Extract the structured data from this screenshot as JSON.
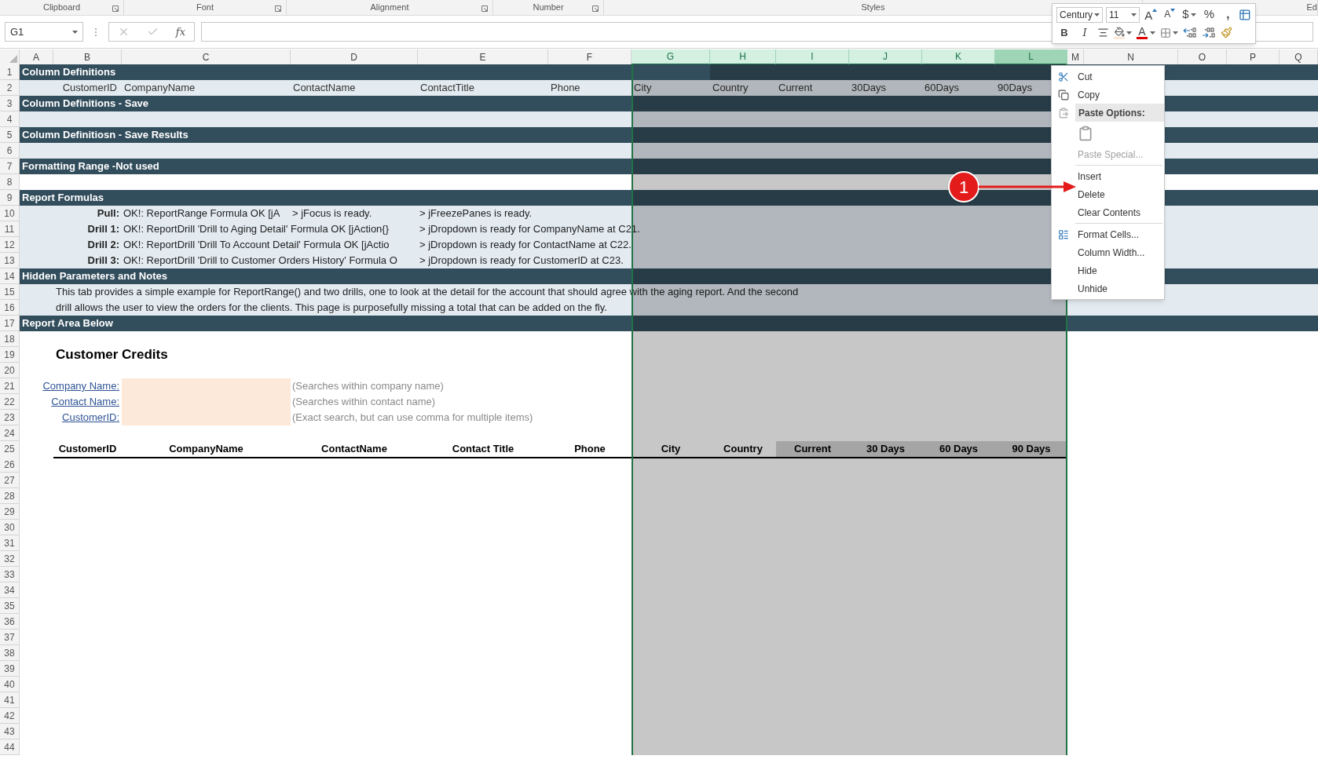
{
  "ribbon_groups": [
    {
      "label": "Clipboard",
      "launcher": true
    },
    {
      "label": "Font",
      "launcher": true
    },
    {
      "label": "Alignment",
      "launcher": true
    },
    {
      "label": "Number",
      "launcher": true
    },
    {
      "label": "Styles",
      "launcher": false
    },
    {
      "label": "Ed",
      "launcher": false
    }
  ],
  "formula_bar": {
    "name_box": "G1",
    "function_symbol": "fx"
  },
  "columns": [
    {
      "label": "A",
      "selected": false,
      "hovered": false
    },
    {
      "label": "B",
      "selected": false,
      "hovered": false
    },
    {
      "label": "C",
      "selected": false,
      "hovered": false
    },
    {
      "label": "D",
      "selected": false,
      "hovered": false
    },
    {
      "label": "E",
      "selected": false,
      "hovered": false
    },
    {
      "label": "F",
      "selected": false,
      "hovered": false
    },
    {
      "label": "G",
      "selected": true,
      "hovered": false
    },
    {
      "label": "H",
      "selected": true,
      "hovered": false
    },
    {
      "label": "I",
      "selected": true,
      "hovered": false
    },
    {
      "label": "J",
      "selected": true,
      "hovered": false
    },
    {
      "label": "K",
      "selected": true,
      "hovered": false
    },
    {
      "label": "L",
      "selected": true,
      "hovered": true
    },
    {
      "label": "M",
      "selected": false,
      "hovered": false
    },
    {
      "label": "N",
      "selected": false,
      "hovered": false
    },
    {
      "label": "O",
      "selected": false,
      "hovered": false
    },
    {
      "label": "P",
      "selected": false,
      "hovered": false
    },
    {
      "label": "Q",
      "selected": false,
      "hovered": false
    }
  ],
  "rows": [
    {
      "number": "1",
      "kind": "section",
      "title": "Column Definitions"
    },
    {
      "number": "2",
      "kind": "definitions",
      "values": [
        "CustomerID",
        "CompanyName",
        "ContactName",
        "ContactTitle",
        "Phone",
        "City",
        "Country",
        "Current",
        "30Days",
        "60Days",
        "90Days"
      ]
    },
    {
      "number": "3",
      "kind": "section",
      "title": "Column Definitions - Save"
    },
    {
      "number": "4",
      "kind": "light_blank"
    },
    {
      "number": "5",
      "kind": "section",
      "title": "Column Definitiosn - Save Results"
    },
    {
      "number": "6",
      "kind": "light_blank"
    },
    {
      "number": "7",
      "kind": "section",
      "title": "Formatting Range -Not used"
    },
    {
      "number": "8",
      "kind": "blank"
    },
    {
      "number": "9",
      "kind": "section",
      "title": "Report Formulas"
    },
    {
      "number": "10",
      "kind": "formula",
      "label": "Pull:",
      "result": "OK!: ReportRange Formula OK [jA",
      "messages": [
        "> jFocus is ready.",
        "> jFreezePanes is ready."
      ]
    },
    {
      "number": "11",
      "kind": "formula",
      "label": "Drill 1:",
      "result": "OK!: ReportDrill 'Drill to Aging Detail' Formula OK [jAction{}",
      "messages": [
        "> jDropdown is ready for CompanyName at C21."
      ]
    },
    {
      "number": "12",
      "kind": "formula",
      "label": "Drill 2:",
      "result": "OK!: ReportDrill 'Drill To Account Detail' Formula OK [jActio",
      "messages": [
        "> jDropdown is ready for ContactName at C22."
      ]
    },
    {
      "number": "13",
      "kind": "formula",
      "label": "Drill 3:",
      "result": "OK!: ReportDrill 'Drill to Customer Orders History' Formula O",
      "messages": [
        "> jDropdown is ready for CustomerID at C23."
      ]
    },
    {
      "number": "14",
      "kind": "section",
      "title": "Hidden Parameters and Notes"
    },
    {
      "number": "15",
      "kind": "note",
      "text": "This tab provides a simple example for ReportRange() and two drills, one to look at the detail for the account that should agree with the aging report. And the second"
    },
    {
      "number": "16",
      "kind": "note",
      "text": "drill allows the user to view the orders for the clients.   This page is purposefully missing a total that can be added on the fly."
    },
    {
      "number": "17",
      "kind": "section",
      "title": "Report Area Below"
    },
    {
      "number": "18",
      "kind": "blank"
    },
    {
      "number": "19",
      "kind": "title",
      "text": "Customer Credits"
    },
    {
      "number": "20",
      "kind": "blank"
    },
    {
      "number": "21",
      "kind": "search",
      "label": "Company Name:",
      "hint": "(Searches within company name)"
    },
    {
      "number": "22",
      "kind": "search",
      "label": "Contact Name:",
      "hint": "(Searches within contact name)"
    },
    {
      "number": "23",
      "kind": "search",
      "label": "CustomerID:",
      "hint": "(Exact search, but can use comma for multiple items)"
    },
    {
      "number": "24",
      "kind": "blank"
    },
    {
      "number": "25",
      "kind": "table_header",
      "cells": [
        {
          "label": "CustomerID",
          "shaded": false
        },
        {
          "label": "CompanyName",
          "shaded": false
        },
        {
          "label": "ContactName",
          "shaded": false
        },
        {
          "label": "Contact Title",
          "shaded": false
        },
        {
          "label": "Phone",
          "shaded": false
        },
        {
          "label": "City",
          "shaded": false
        },
        {
          "label": "Country",
          "shaded": false
        },
        {
          "label": "Current",
          "shaded": true
        },
        {
          "label": "30 Days",
          "shaded": true
        },
        {
          "label": "60 Days",
          "shaded": true
        },
        {
          "label": "90 Days",
          "shaded": true
        }
      ]
    },
    {
      "number": "26",
      "kind": "blank"
    },
    {
      "number": "27",
      "kind": "blank"
    },
    {
      "number": "28",
      "kind": "blank"
    },
    {
      "number": "29",
      "kind": "blank"
    },
    {
      "number": "30",
      "kind": "blank"
    },
    {
      "number": "31",
      "kind": "blank"
    },
    {
      "number": "32",
      "kind": "blank"
    },
    {
      "number": "33",
      "kind": "blank"
    },
    {
      "number": "34",
      "kind": "blank"
    },
    {
      "number": "35",
      "kind": "blank"
    },
    {
      "number": "36",
      "kind": "blank"
    },
    {
      "number": "37",
      "kind": "blank"
    },
    {
      "number": "38",
      "kind": "blank"
    },
    {
      "number": "39",
      "kind": "blank"
    },
    {
      "number": "40",
      "kind": "blank"
    },
    {
      "number": "41",
      "kind": "blank"
    },
    {
      "number": "42",
      "kind": "blank"
    },
    {
      "number": "43",
      "kind": "blank"
    },
    {
      "number": "44",
      "kind": "blank"
    }
  ],
  "mini_toolbar": {
    "font": "Century",
    "size": "11",
    "top_buttons": [
      {
        "kind": "grow",
        "label": "A"
      },
      {
        "kind": "shrink",
        "label": "A"
      },
      {
        "kind": "currency",
        "label": "$"
      },
      {
        "kind": "percent",
        "label": "%"
      },
      {
        "kind": "comma",
        "label": ","
      },
      {
        "kind": "table"
      }
    ],
    "bottom_buttons": [
      {
        "kind": "bold",
        "label": "B"
      },
      {
        "kind": "italic",
        "label": "I"
      },
      {
        "kind": "align"
      },
      {
        "kind": "fill"
      },
      {
        "kind": "font_color",
        "label": "A"
      },
      {
        "kind": "borders"
      },
      {
        "kind": "decimal_more"
      },
      {
        "kind": "decimal_less"
      },
      {
        "kind": "painter"
      }
    ]
  },
  "context_menu": [
    {
      "kind": "cut",
      "label": "Cut",
      "disabled": false
    },
    {
      "kind": "copy",
      "label": "Copy",
      "disabled": false
    },
    {
      "kind": "paste_header",
      "label": "Paste Options:",
      "disabled": false
    },
    {
      "kind": "paste_button",
      "disabled": false
    },
    {
      "kind": "plain",
      "label": "Paste Special...",
      "disabled": true
    },
    {
      "kind": "separator"
    },
    {
      "kind": "plain",
      "label": "Insert",
      "disabled": false
    },
    {
      "kind": "plain",
      "label": "Delete",
      "disabled": false
    },
    {
      "kind": "plain",
      "label": "Clear Contents",
      "disabled": false
    },
    {
      "kind": "separator"
    },
    {
      "kind": "format",
      "label": "Format Cells...",
      "disabled": false
    },
    {
      "kind": "plain",
      "label": "Column Width...",
      "disabled": false
    },
    {
      "kind": "plain",
      "label": "Hide",
      "disabled": false
    },
    {
      "kind": "plain",
      "label": "Unhide",
      "disabled": false
    }
  ],
  "annotation": {
    "label": "1"
  }
}
